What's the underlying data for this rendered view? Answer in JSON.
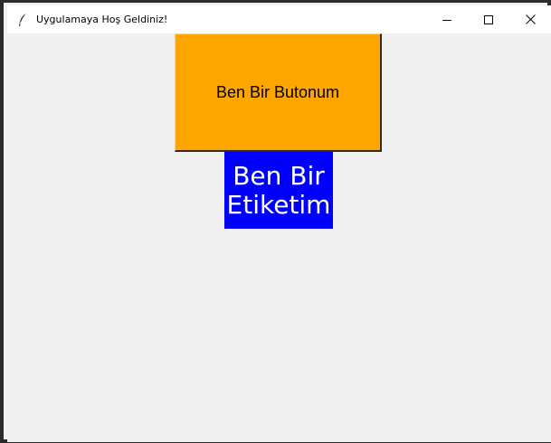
{
  "window": {
    "title": "Uygulamaya Hoş Geldiniz!",
    "app_icon": "feather-icon",
    "controls": [
      "minimize-icon",
      "maximize-icon",
      "close-icon"
    ]
  },
  "content": {
    "button_label": "Ben Bir Butonum",
    "button_color": "#ffa500",
    "label_line1": "Ben Bir",
    "label_line2": "Etiketim",
    "label_bg_color": "#0000ff",
    "label_text_color": "#ffffff"
  }
}
